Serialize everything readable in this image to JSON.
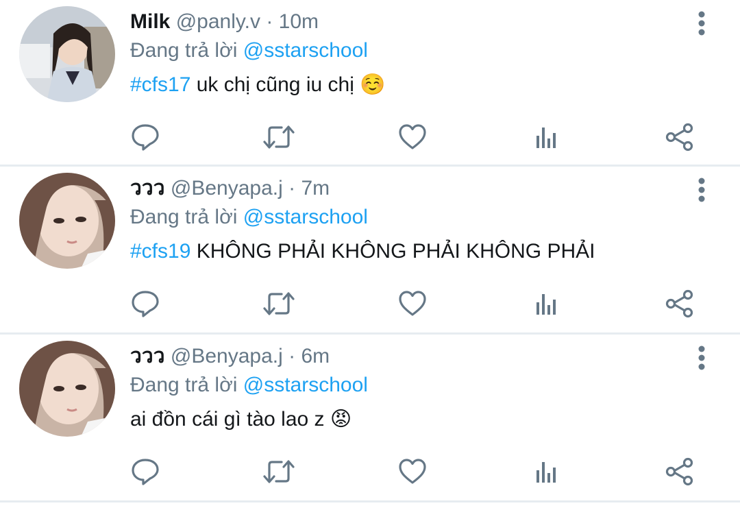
{
  "tweets": [
    {
      "name": "Milk",
      "handle": "@panly.v",
      "separator": "·",
      "time": "10m",
      "reply_prefix": "Đang trả lời ",
      "reply_to": "@sstarschool",
      "hashtag": "#cfs17",
      "text": " uk chị cũng iu chị ",
      "emoji": "☺️"
    },
    {
      "name": "ววว",
      "handle": "@Benyapa.j",
      "separator": "·",
      "time": "7m",
      "reply_prefix": "Đang trả lời ",
      "reply_to": "@sstarschool",
      "hashtag": "#cfs19",
      "text": " KHÔNG PHẢI KHÔNG PHẢI KHÔNG PHẢI",
      "emoji": ""
    },
    {
      "name": "ววว",
      "handle": "@Benyapa.j",
      "separator": "·",
      "time": "6m",
      "reply_prefix": "Đang trả lời ",
      "reply_to": "@sstarschool",
      "hashtag": "",
      "text": "ai đồn cái gì tào lao z ",
      "emoji": "😡"
    }
  ],
  "icons": {
    "reply": "reply-icon",
    "retweet": "retweet-icon",
    "like": "heart-icon",
    "stats": "analytics-icon",
    "share": "share-icon",
    "more": "more-vertical-icon"
  },
  "colors": {
    "link": "#1da1f2",
    "muted": "#657786",
    "icon": "#657786",
    "divider": "#e6ecf0"
  }
}
